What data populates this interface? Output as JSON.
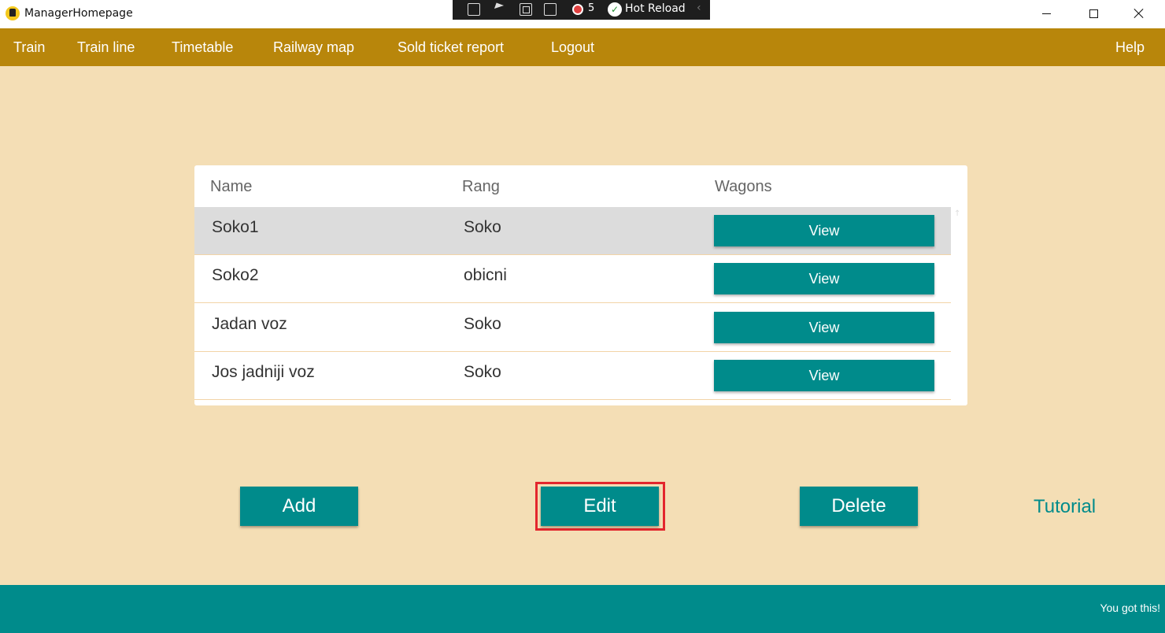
{
  "window": {
    "title": "ManagerHomepage",
    "icon": "train-app-icon"
  },
  "debug_toolbar": {
    "error_count": "5",
    "hot_reload_label": "Hot Reload"
  },
  "menu": {
    "items": [
      {
        "label": "Train"
      },
      {
        "label": "Train line"
      },
      {
        "label": "Timetable"
      },
      {
        "label": "Railway map"
      },
      {
        "label": "Sold ticket report"
      },
      {
        "label": "Logout"
      }
    ],
    "help_label": "Help"
  },
  "table": {
    "columns": [
      "Name",
      "Rang",
      "Wagons"
    ],
    "rows": [
      {
        "name": "Soko1",
        "rang": "Soko",
        "wagons_button": "View",
        "selected": true
      },
      {
        "name": "Soko2",
        "rang": "obicni",
        "wagons_button": "View",
        "selected": false
      },
      {
        "name": "Jadan voz",
        "rang": "Soko",
        "wagons_button": "View",
        "selected": false
      },
      {
        "name": "Jos jadniji voz",
        "rang": "Soko",
        "wagons_button": "View",
        "selected": false
      }
    ]
  },
  "actions": {
    "add_label": "Add",
    "edit_label": "Edit",
    "delete_label": "Delete",
    "tutorial_label": "Tutorial"
  },
  "footer": {
    "message": "You got this!"
  },
  "colors": {
    "background": "#f4deb5",
    "menubar": "#b8860b",
    "accent": "#008b8b",
    "highlight": "#e3262d",
    "selected_row": "#dcdcdc"
  }
}
